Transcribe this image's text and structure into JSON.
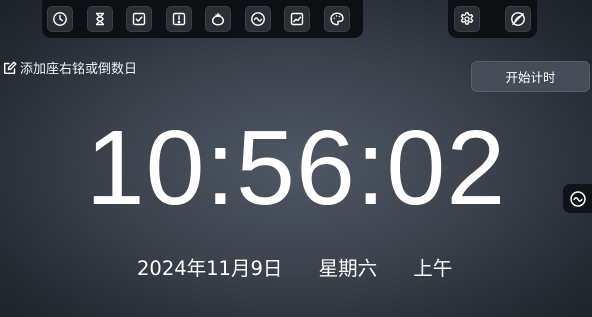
{
  "toolbar": {
    "tools": [
      {
        "name": "clock-icon"
      },
      {
        "name": "hourglass-icon"
      },
      {
        "name": "checkbox-icon"
      },
      {
        "name": "alert-icon"
      },
      {
        "name": "tomato-icon"
      },
      {
        "name": "wave-icon"
      },
      {
        "name": "chart-icon"
      },
      {
        "name": "palette-icon"
      }
    ],
    "right_tools": [
      {
        "name": "settings-icon"
      },
      {
        "name": "no-sleep-icon"
      }
    ]
  },
  "motto": {
    "label": "添加座右铭或倒数日"
  },
  "start_timer": {
    "label": "开始计时"
  },
  "clock": {
    "time": "10:56:02",
    "date": "2024年11月9日",
    "weekday": "星期六",
    "period": "上午"
  },
  "side_toggle": {
    "icon": "wave-icon"
  },
  "colors": {
    "toolbar_bg": "#0d0f12",
    "button_bg": "#2a2f36",
    "start_button_bg": "#454c57",
    "text": "#ffffff"
  }
}
